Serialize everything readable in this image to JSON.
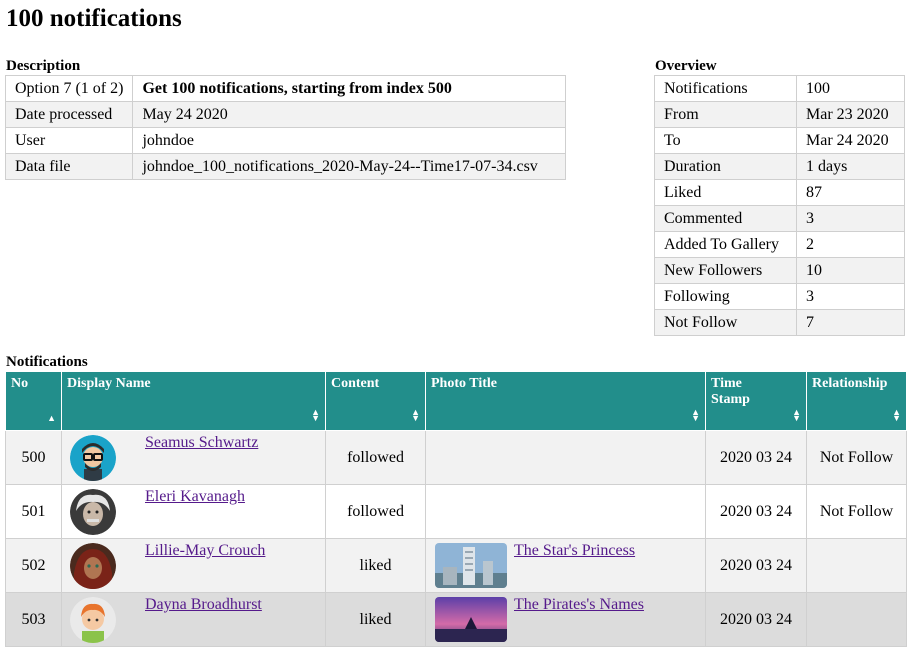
{
  "page_title": "100 notifications",
  "description": {
    "caption": "Description",
    "rows": [
      {
        "key": "Option 7 (1 of 2)",
        "value": "Get 100 notifications, starting from index 500"
      },
      {
        "key": "Date processed",
        "value": "May 24 2020"
      },
      {
        "key": "User",
        "value": "johndoe"
      },
      {
        "key": "Data file",
        "value": "johndoe_100_notifications_2020-May-24--Time17-07-34.csv"
      }
    ]
  },
  "overview": {
    "caption": "Overview",
    "rows": [
      {
        "key": "Notifications",
        "value": "100"
      },
      {
        "key": "From",
        "value": "Mar 23 2020"
      },
      {
        "key": "To",
        "value": "Mar 24 2020"
      },
      {
        "key": "Duration",
        "value": "1 days"
      },
      {
        "key": "Liked",
        "value": "87"
      },
      {
        "key": "Commented",
        "value": "3"
      },
      {
        "key": "Added To Gallery",
        "value": "2"
      },
      {
        "key": "New Followers",
        "value": "10"
      },
      {
        "key": "Following",
        "value": "3"
      },
      {
        "key": "Not Follow",
        "value": "7"
      }
    ]
  },
  "notifications": {
    "caption": "Notifications",
    "columns": [
      {
        "label": "No",
        "sort_icon": "sort-asc-icon"
      },
      {
        "label": "Display Name",
        "sort_icon": "sort-both-icon"
      },
      {
        "label": "Content",
        "sort_icon": "sort-both-icon"
      },
      {
        "label": "Photo Title",
        "sort_icon": "sort-both-icon"
      },
      {
        "label": "Time Stamp",
        "sort_icon": "sort-both-icon"
      },
      {
        "label": "Relationship",
        "sort_icon": "sort-both-icon"
      }
    ],
    "rows": [
      {
        "no": "500",
        "name": "Seamus Schwartz",
        "avatar": "avatar-glasses-man",
        "content": "followed",
        "photo_title": "",
        "photo_thumb": "",
        "timestamp": "2020 03 24",
        "relationship": "Not Follow"
      },
      {
        "no": "501",
        "name": "Eleri Kavanagh",
        "avatar": "avatar-einstein",
        "content": "followed",
        "photo_title": "",
        "photo_thumb": "",
        "timestamp": "2020 03 24",
        "relationship": "Not Follow"
      },
      {
        "no": "502",
        "name": "Lillie-May Crouch",
        "avatar": "avatar-woman-scarf",
        "content": "liked",
        "photo_title": "The Star's Princess",
        "photo_thumb": "thumb-tower",
        "timestamp": "2020 03 24",
        "relationship": ""
      },
      {
        "no": "503",
        "name": "Dayna Broadhurst",
        "avatar": "avatar-cartoon-boy",
        "content": "liked",
        "photo_title": "The Pirates's Names",
        "photo_thumb": "thumb-sunset",
        "timestamp": "2020 03 24",
        "relationship": ""
      }
    ]
  },
  "colors": {
    "header_bg": "#228e8b",
    "link": "#551a8b"
  }
}
